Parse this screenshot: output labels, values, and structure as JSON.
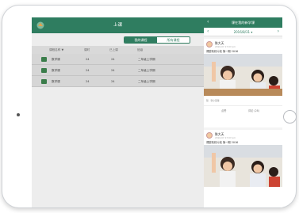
{
  "window": {
    "title": "上课"
  },
  "segments": [
    {
      "label": "我的课程",
      "active": true
    },
    {
      "label": "所有课程",
      "active": false
    }
  ],
  "table": {
    "headers": [
      "课程名称 ▼",
      "课时",
      "已上课",
      "班级"
    ],
    "rows": [
      {
        "name": "数学课",
        "hours": "24",
        "done": "24",
        "class": "二年级上学期"
      },
      {
        "name": "数学课",
        "hours": "24",
        "done": "24",
        "class": "二年级上学期"
      },
      {
        "name": "数学课",
        "hours": "24",
        "done": "24",
        "class": "二年级上学期"
      }
    ]
  },
  "right_panel": {
    "title": "课在我的新学课",
    "back_glyph": "‹",
    "date": "2016/8/31 ▾",
    "prev_glyph": "‹",
    "next_glyph": "›",
    "posts": [
      {
        "author": "陈大天",
        "time": "2016-07 17:07 pm",
        "text": "课堂精彩片段 第一期 2016",
        "likes": "赞 · 张小丽等",
        "like_label": "点赞",
        "comment_label": "评论 (28)"
      },
      {
        "author": "陈大天",
        "time": "2016-07 17:07 pm",
        "text": "课堂精彩片段 第一期 2016"
      }
    ]
  },
  "colors": {
    "accent": "#2f7d60",
    "row_bg": "#d6d6d6",
    "header_bg": "#d9d9d9"
  },
  "icons": {
    "logo": "app-logo-icon",
    "course": "book-icon",
    "home": "home-button"
  }
}
